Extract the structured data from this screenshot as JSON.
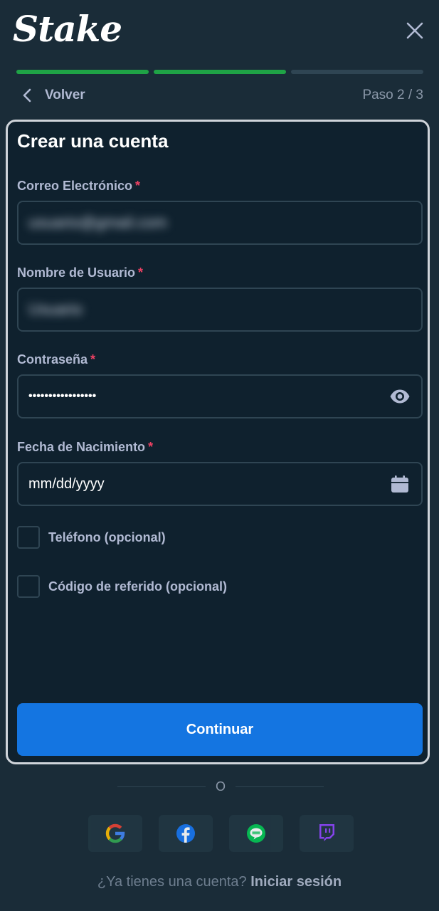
{
  "header": {
    "logo_text": "Stake",
    "close_label": "×"
  },
  "progress": {
    "steps_total": 3,
    "steps_done": 2,
    "back_label": "Volver",
    "step_text": "Paso 2 / 3"
  },
  "form": {
    "title": "Crear una cuenta",
    "required_mark": "*",
    "email": {
      "label": "Correo Electrónico",
      "value": "usuario@gmail.com"
    },
    "username": {
      "label": "Nombre de Usuario",
      "value": "Usuario"
    },
    "password": {
      "label": "Contraseña",
      "value": "•••••••••••••••••"
    },
    "birthdate": {
      "label": "Fecha de Nacimiento",
      "value": "mm/dd/yyyy"
    },
    "phone_checkbox": {
      "label": "Teléfono (opcional)",
      "checked": false
    },
    "referral_checkbox": {
      "label": "Código de referido (opcional)",
      "checked": false
    },
    "continue_label": "Continuar"
  },
  "divider_text": "O",
  "social": [
    "google-icon",
    "facebook-icon",
    "line-icon",
    "twitch-icon"
  ],
  "login": {
    "question": "¿Ya tienes una cuenta?",
    "link": "Iniciar sesión"
  },
  "colors": {
    "background": "#1a2c38",
    "card": "#0f212e",
    "progress_done": "#1fa346",
    "primary_button": "#1475e1",
    "required": "#ed4163"
  }
}
